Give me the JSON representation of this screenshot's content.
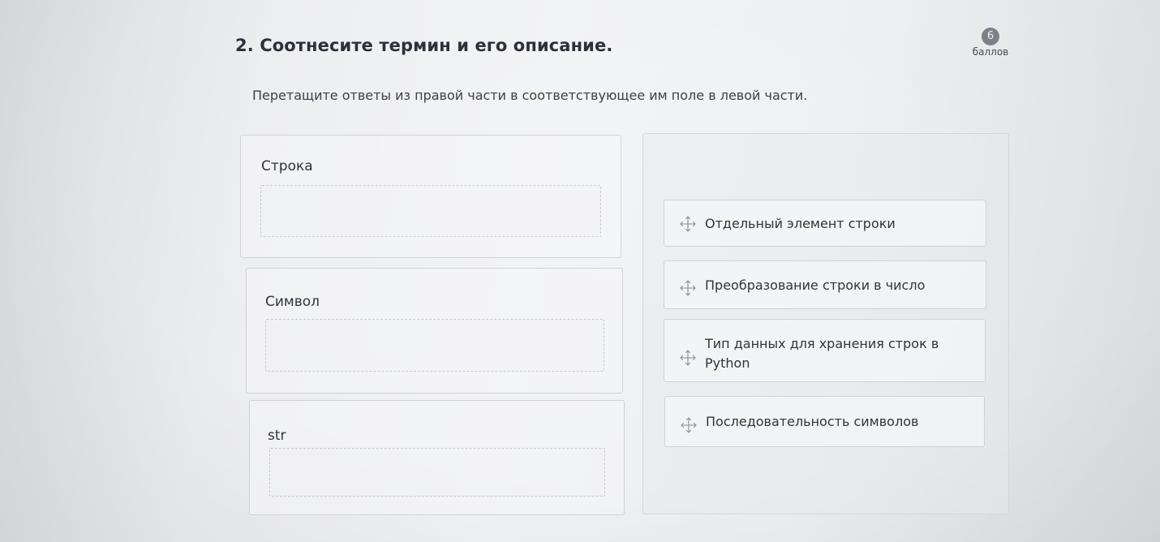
{
  "question": {
    "title": "2. Соотнесите термин и его описание.",
    "points_value": "6",
    "points_label": "баллов",
    "instruction": "Перетащите ответы из правой части в соответствующее им поле в левой части."
  },
  "terms": [
    {
      "label": "Строка"
    },
    {
      "label": "Символ"
    },
    {
      "label": "str"
    }
  ],
  "answers": [
    {
      "label": "Отдельный элемент строки",
      "icon": "move-icon"
    },
    {
      "label": "Преобразование строки в число",
      "icon": "move-icon"
    },
    {
      "label": "Тип данных для хранения строк в Python",
      "icon": "move-icon"
    },
    {
      "label": "Последовательность символов",
      "icon": "move-icon"
    }
  ]
}
